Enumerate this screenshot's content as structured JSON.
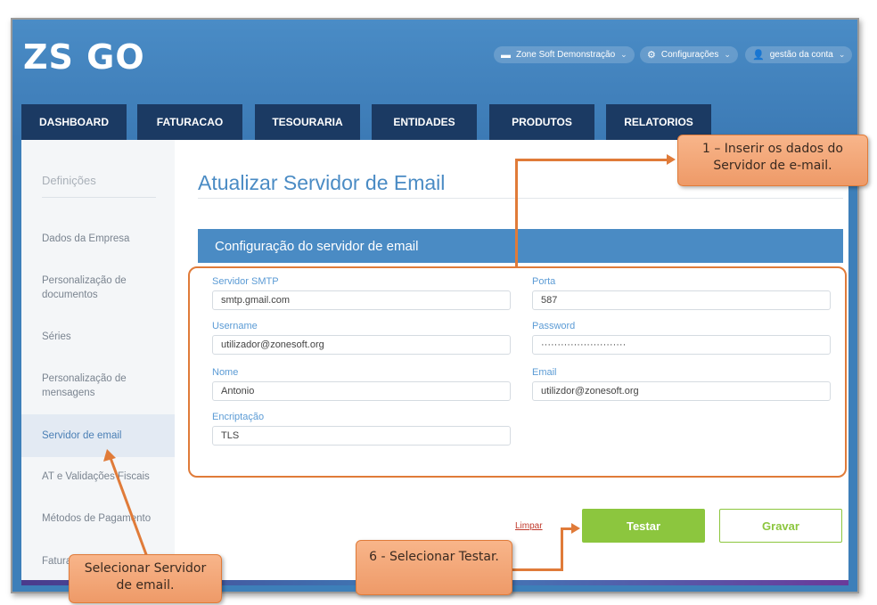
{
  "brand": {
    "logo_text": "ZS GO"
  },
  "topbar": {
    "company": "Zone Soft Demonstração",
    "settings": "Configurações",
    "account": "gestão da conta"
  },
  "nav": {
    "tabs": [
      "DASHBOARD",
      "FATURACAO",
      "TESOURARIA",
      "ENTIDADES",
      "PRODUTOS",
      "RELATORIOS"
    ]
  },
  "sidebar": {
    "title": "Definições",
    "items": [
      "Dados da Empresa",
      "Personalização de documentos",
      "Séries",
      "Personalização de mensagens",
      "Servidor de email",
      "AT e Validações Fiscais",
      "Métodos de Pagamento",
      "Fatura"
    ]
  },
  "main": {
    "title": "Atualizar Servidor de Email",
    "section": "Configuração do servidor de email"
  },
  "form": {
    "smtp_label": "Servidor SMTP",
    "smtp_value": "smtp.gmail.com",
    "port_label": "Porta",
    "port_value": "587",
    "username_label": "Username",
    "username_value": "utilizador@zonesoft.org",
    "password_label": "Password",
    "password_value": "··························",
    "name_label": "Nome",
    "name_value": "Antonio",
    "email_label": "Email",
    "email_value": "utilizdor@zonesoft.org",
    "encryption_label": "Encriptação",
    "encryption_value": "TLS"
  },
  "actions": {
    "clear": "Limpar",
    "test": "Testar",
    "save": "Gravar"
  },
  "annotations": {
    "step1": "1 – Inserir os dados do Servidor de e-mail.",
    "select_server": "Selecionar Servidor de email.",
    "step6": "6 - Selecionar Testar."
  },
  "colors": {
    "brand_blue": "#3d7fb9",
    "nav_dark": "#1b3a63",
    "accent_green": "#8cc63e",
    "callout_orange": "#e07b39"
  }
}
